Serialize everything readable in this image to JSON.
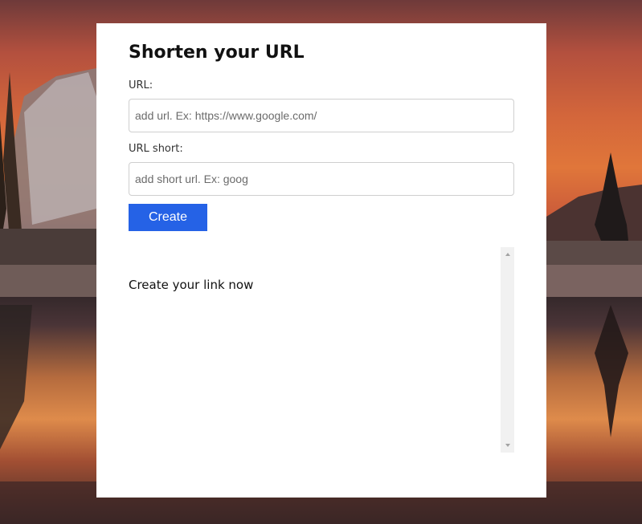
{
  "form": {
    "title": "Shorten your URL",
    "url_label": "URL:",
    "url_placeholder": "add url. Ex: https://www.google.com/",
    "url_value": "",
    "short_label": "URL short:",
    "short_placeholder": "add short url. Ex: goog",
    "short_value": "",
    "create_label": "Create"
  },
  "results": {
    "message": "Create your link now"
  },
  "colors": {
    "accent": "#2562e6",
    "card_background": "#ffffff"
  },
  "icons": {
    "scroll_up": "triangle-up",
    "scroll_down": "triangle-down"
  }
}
